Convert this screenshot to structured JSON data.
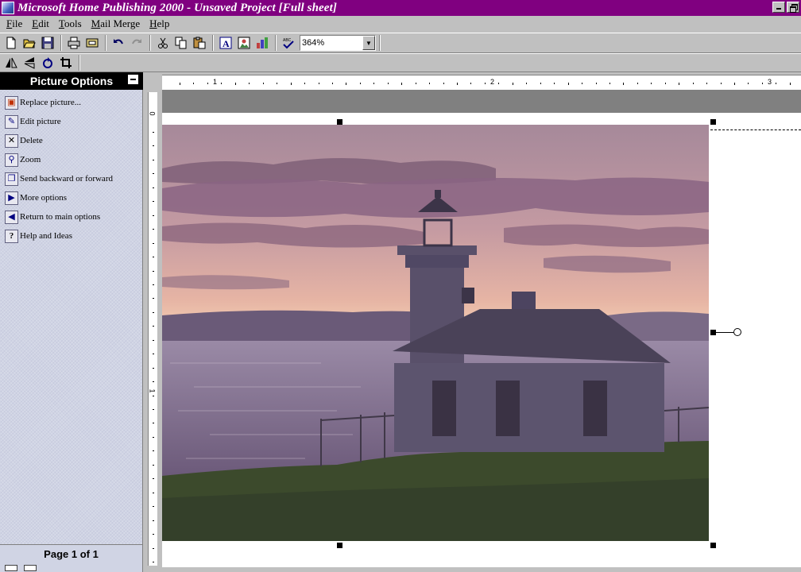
{
  "window": {
    "title": "Microsoft Home Publishing 2000 - Unsaved Project [Full sheet]"
  },
  "menu": {
    "items": [
      {
        "first": "F",
        "rest": "ile"
      },
      {
        "first": "E",
        "rest": "dit"
      },
      {
        "first": "T",
        "rest": "ools"
      },
      {
        "first": "M",
        "rest": "ail Merge"
      },
      {
        "first": "H",
        "rest": "elp"
      }
    ]
  },
  "toolbar": {
    "zoom_value": "364%"
  },
  "panel": {
    "title": "Picture Options",
    "options": [
      {
        "label": "Replace picture...",
        "icon": "replace-picture-icon"
      },
      {
        "label": "Edit picture",
        "icon": "edit-picture-icon"
      },
      {
        "label": "Delete",
        "icon": "delete-icon"
      },
      {
        "label": "Zoom",
        "icon": "zoom-icon"
      },
      {
        "label": "Send backward or forward",
        "icon": "send-backward-icon"
      },
      {
        "label": "More options",
        "icon": "more-options-icon"
      },
      {
        "label": "Return to main options",
        "icon": "return-icon"
      },
      {
        "label": "Help and Ideas",
        "icon": "help-icon"
      }
    ],
    "page_indicator": "Page 1 of 1"
  },
  "ruler": {
    "top_numbers": [
      "1",
      "2",
      "3"
    ],
    "left_numbers": [
      "0",
      "1"
    ]
  },
  "colors": {
    "titlebar": "#800080",
    "panel_bg": "#d0d4e4"
  }
}
